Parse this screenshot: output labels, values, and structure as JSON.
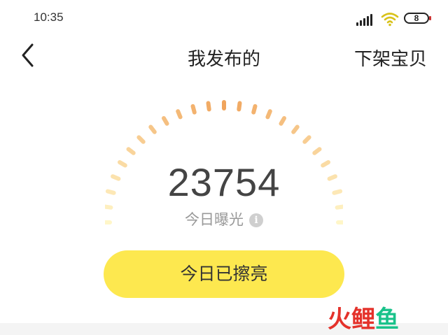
{
  "status_bar": {
    "time": "10:35",
    "battery": "8"
  },
  "nav": {
    "back_icon": "chevron-left-icon",
    "title": "我发布的",
    "right_action": "下架宝贝"
  },
  "exposure": {
    "count": "23754",
    "label": "今日曝光",
    "info_icon": "info-icon",
    "info_glyph": "i"
  },
  "action_button": {
    "label": "今日已擦亮"
  },
  "watermark": {
    "chars": [
      "火",
      "鲤",
      "鱼"
    ]
  },
  "colors": {
    "button_yellow": "#fde84f",
    "gauge_start": "#fff6c8",
    "gauge_end": "#f0a45c",
    "watermark_red": "#e4322b",
    "watermark_green": "#19c28a"
  }
}
